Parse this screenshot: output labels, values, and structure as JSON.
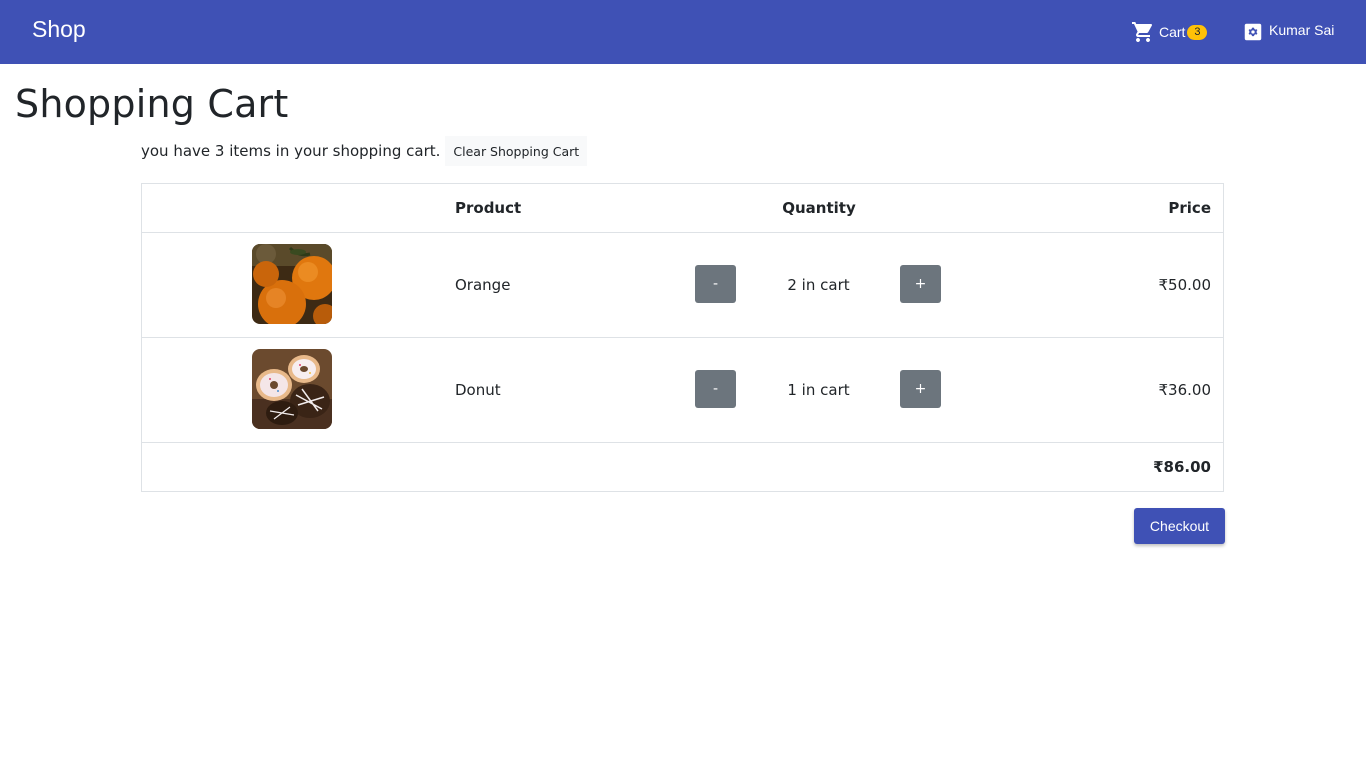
{
  "navbar": {
    "brand": "Shop",
    "cart_label": "Cart",
    "cart_count": "3",
    "user_name": "Kumar Sai",
    "icons": {
      "cart": "shopping-cart-icon",
      "user": "settings-gear-icon"
    },
    "background_color": "#3f51b5",
    "badge_color": "#ffc107"
  },
  "page": {
    "title": "Shopping Cart",
    "summary": "you have 3 items in your shopping cart.",
    "clear_button": "Clear Shopping Cart"
  },
  "table": {
    "headers": {
      "product": "Product",
      "quantity": "Quantity",
      "price": "Price"
    },
    "items": [
      {
        "name": "Orange",
        "image": "orange-photo",
        "decrement": "-",
        "quantity": "2 in cart",
        "increment": "+",
        "price": "₹50.00"
      },
      {
        "name": "Donut",
        "image": "donut-photo",
        "decrement": "-",
        "quantity": "1 in cart",
        "increment": "+",
        "price": "₹36.00"
      }
    ],
    "total": "₹86.00"
  },
  "checkout_button": "Checkout",
  "colors": {
    "primary": "#3f51b5",
    "secondary_button": "#6c757d",
    "border": "#dee2e6"
  }
}
